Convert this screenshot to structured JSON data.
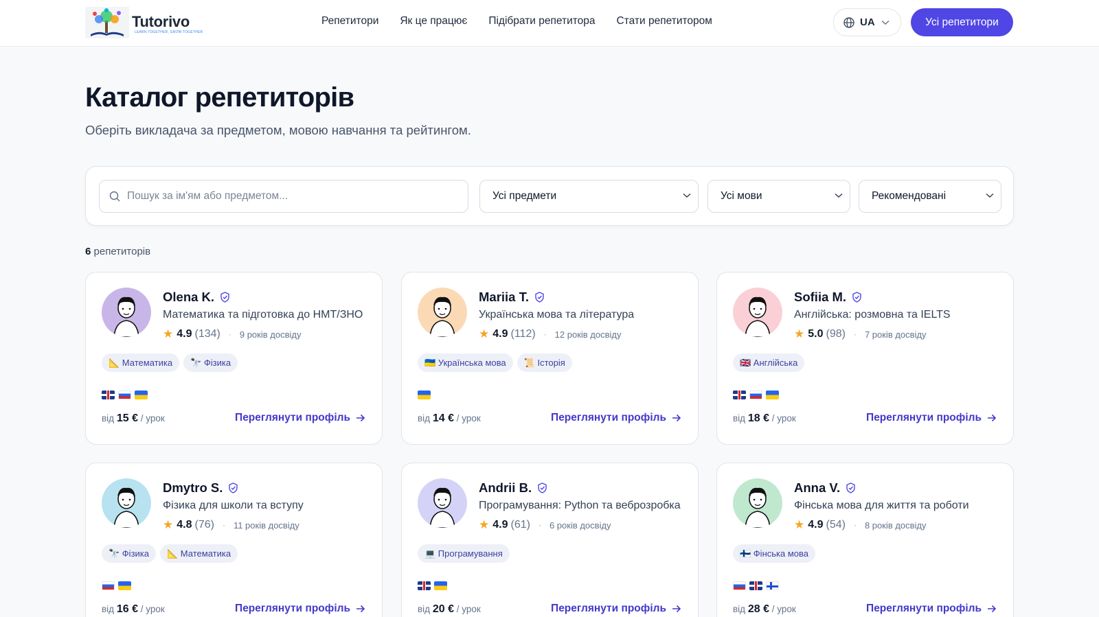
{
  "header": {
    "logo_text": "Tutorivo",
    "logo_tagline": "LEARN TOGETHER, GROW TOGETHER",
    "nav": [
      "Репетитори",
      "Як це працює",
      "Підібрати репетитора",
      "Стати репетитором"
    ],
    "lang": "UA",
    "cta": "Усі репетитори"
  },
  "page": {
    "title": "Каталог репетиторів",
    "subtitle": "Оберіть викладача за предметом, мовою навчання та рейтингом."
  },
  "filters": {
    "search_placeholder": "Пошук за ім'ям або предметом...",
    "subject": "Усі предмети",
    "language": "Усі мови",
    "sort": "Рекомендовані"
  },
  "results": {
    "count": "6",
    "count_label": "репетиторів"
  },
  "card_common": {
    "price_prefix": "від",
    "price_suffix": "/ урок",
    "view_profile": "Переглянути профіль",
    "dot": "·"
  },
  "tutors": [
    {
      "name": "Olena K.",
      "subject": "Математика та підготовка до НМТ/ЗНО",
      "rating": "4.9",
      "reviews": "(134)",
      "experience": "9 років досвіду",
      "tags": [
        "📐 Математика",
        "🔭 Фізика"
      ],
      "flags": [
        "gb",
        "ru",
        "ua"
      ],
      "price": "15 €",
      "avatar_bg": "#c9b6e8"
    },
    {
      "name": "Mariia T.",
      "subject": "Українська мова та література",
      "rating": "4.9",
      "reviews": "(112)",
      "experience": "12 років досвіду",
      "tags": [
        "🇺🇦 Українська мова",
        "📜 Історія"
      ],
      "flags": [
        "ua"
      ],
      "price": "14 €",
      "avatar_bg": "#fcd9b5"
    },
    {
      "name": "Sofiia M.",
      "subject": "Англійська: розмовна та IELTS",
      "rating": "5.0",
      "reviews": "(98)",
      "experience": "7 років досвіду",
      "tags": [
        "🇬🇧 Англійська"
      ],
      "flags": [
        "gb",
        "ru",
        "ua"
      ],
      "price": "18 €",
      "avatar_bg": "#fbcfd6"
    },
    {
      "name": "Dmytro S.",
      "subject": "Фізика для школи та вступу",
      "rating": "4.8",
      "reviews": "(76)",
      "experience": "11 років досвіду",
      "tags": [
        "🔭 Фізика",
        "📐 Математика"
      ],
      "flags": [
        "ru",
        "ua"
      ],
      "price": "16 €",
      "avatar_bg": "#b8e2ef"
    },
    {
      "name": "Andrii B.",
      "subject": "Програмування: Python та веброзробка",
      "rating": "4.9",
      "reviews": "(61)",
      "experience": "6 років досвіду",
      "tags": [
        "💻 Програмування"
      ],
      "flags": [
        "gb",
        "ua"
      ],
      "price": "20 €",
      "avatar_bg": "#d4d3f7"
    },
    {
      "name": "Anna V.",
      "subject": "Фінська мова для життя та роботи",
      "rating": "4.9",
      "reviews": "(54)",
      "experience": "8 років досвіду",
      "tags": [
        "🇫🇮 Фінська мова"
      ],
      "flags": [
        "ru",
        "gb",
        "fi"
      ],
      "price": "28 €",
      "avatar_bg": "#bfe8cf"
    }
  ]
}
